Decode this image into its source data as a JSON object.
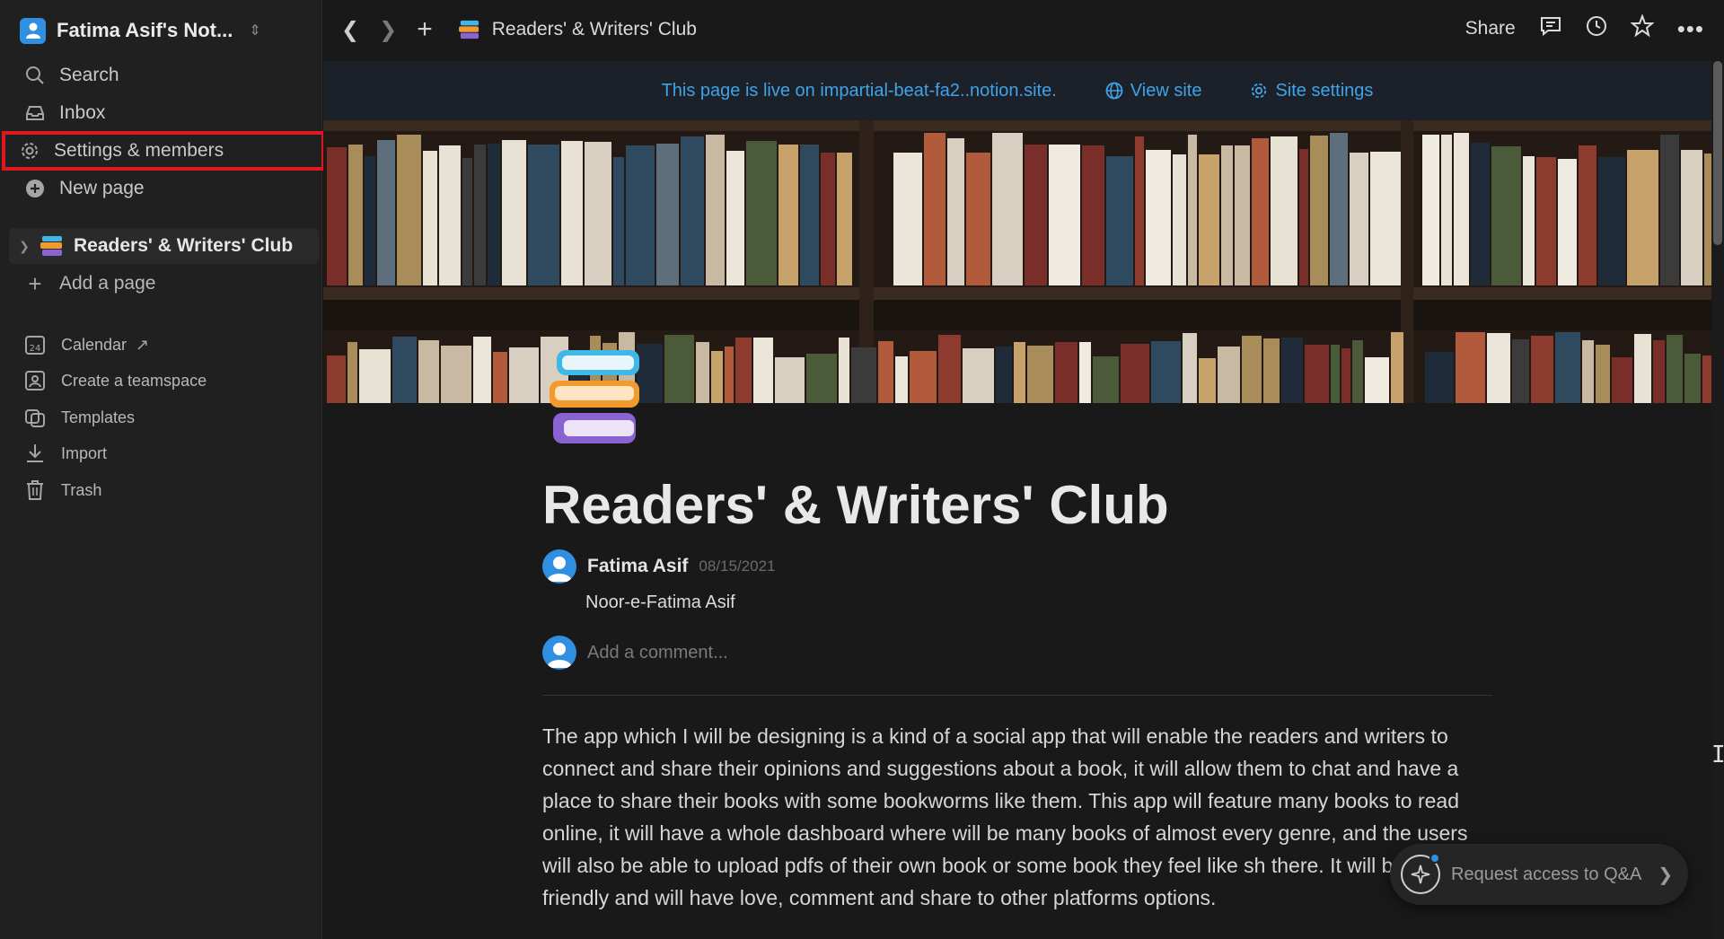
{
  "workspace": {
    "name": "Fatima Asif's Not..."
  },
  "sidebar": {
    "nav": [
      {
        "label": "Search",
        "icon": "search-icon"
      },
      {
        "label": "Inbox",
        "icon": "inbox-icon"
      },
      {
        "label": "Settings & members",
        "icon": "gear-icon",
        "highlighted": true
      },
      {
        "label": "New page",
        "icon": "plus-circle-icon"
      }
    ],
    "pages": [
      {
        "label": "Readers' & Writers' Club",
        "icon": "books-icon"
      }
    ],
    "add_page": "Add a page",
    "extras": [
      {
        "label": "Calendar",
        "icon": "calendar-icon",
        "badge": "24"
      },
      {
        "label": "Create a teamspace",
        "icon": "teamspace-icon"
      },
      {
        "label": "Templates",
        "icon": "templates-icon"
      },
      {
        "label": "Import",
        "icon": "import-icon"
      },
      {
        "label": "Trash",
        "icon": "trash-icon"
      }
    ]
  },
  "topbar": {
    "title": "Readers' & Writers' Club",
    "share": "Share"
  },
  "banner": {
    "text": "This page is live on impartial-beat-fa2..notion.site.",
    "view_site": "View site",
    "site_settings": "Site settings"
  },
  "page": {
    "title": "Readers' & Writers' Club",
    "author": "Fatima Asif",
    "date": "08/15/2021",
    "comment": "Noor-e-Fatima Asif",
    "add_comment_placeholder": "Add a comment...",
    "body": "The app which I will be designing is a kind of a social app that will enable the readers and writers to connect and share their opinions and suggestions about a book, it will allow them to chat and have a place to share their books with some bookworms like them. This app will feature many books to read online, it will have a whole dashboard where will be many books of almost every genre, and the users will also be able to upload pdfs of their own book or some book they feel like sh there. It will be user friendly and will have love, comment and share to other platforms options."
  },
  "qa": {
    "label": "Request access to Q&A"
  },
  "colors": {
    "accent": "#2f8fe0",
    "highlight_box": "#e0161f",
    "link": "#3ea3e8"
  }
}
